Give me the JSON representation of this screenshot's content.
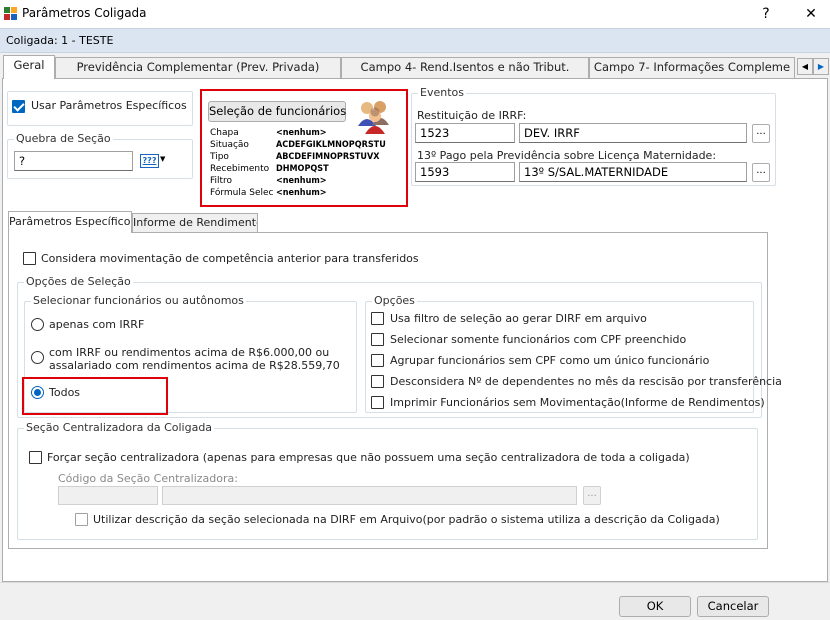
{
  "window": {
    "title": "Parâmetros Coligada",
    "help": "?",
    "close": "✕"
  },
  "infobar": {
    "text": "Coligada: 1 - TESTE"
  },
  "tabs": [
    "Geral",
    "Previdência Complementar (Prev. Privada)",
    "Campo 4- Rend.Isentos e não Tribut.",
    "Campo 7- Informações Compleme"
  ],
  "geral": {
    "usar_parametros_label": "Usar Parâmetros Específicos",
    "usar_parametros_checked": true,
    "quebra_title": "Quebra de Seção",
    "quebra_value": "?",
    "quebra_icon_text": "???"
  },
  "selecao": {
    "button_label": "Seleção de funcionários",
    "rows": [
      {
        "label": "Chapa",
        "value": "<nenhum>"
      },
      {
        "label": "Situação",
        "value": "ACDEFGIKLMNOPQRSTU"
      },
      {
        "label": "Tipo",
        "value": "ABCDEFIMNOPRSTUVX"
      },
      {
        "label": "Recebimento",
        "value": "DHMOPQST"
      },
      {
        "label": "Filtro",
        "value": "<nenhum>"
      },
      {
        "label": "Fórmula Selec",
        "value": "<nenhum>"
      }
    ]
  },
  "eventos": {
    "title": "Eventos",
    "restituicao_label": "Restituição de IRRF:",
    "restituicao_code": "1523",
    "restituicao_desc": "DEV.  IRRF",
    "decimo_label": "13º Pago pela Previdência sobre Licença Maternidade:",
    "decimo_code": "1593",
    "decimo_desc": "13º S/SAL.MATERNIDADE",
    "lookup": "..."
  },
  "subtabs": [
    "Parâmetros Específicos",
    "Informe de Rendimentos"
  ],
  "especificos": {
    "considera_label": "Considera movimentação de competência anterior para transferidos",
    "opcoes_selecao_title": "Opções de Seleção",
    "selecionar_title": "Selecionar funcionários ou autônomos",
    "radio_irrf": "apenas com IRRF",
    "radio_rend_line1": "com IRRF ou rendimentos acima de R$6.000,00 ou",
    "radio_rend_line2": "assalariado com rendimentos acima de R$28.559,70",
    "radio_todos": "Todos",
    "selected": "Todos",
    "opcoes_title": "Opções",
    "opcoes": [
      "Usa filtro de seleção ao gerar DIRF em arquivo",
      "Selecionar somente funcionários com CPF preenchido",
      "Agrupar funcionários sem CPF como um único funcionário",
      "Desconsidera Nº de dependentes no mês da rescisão por transferência",
      "Imprimir Funcionários sem Movimentação(Informe de Rendimentos)"
    ],
    "secao_title": "Seção Centralizadora da Coligada",
    "forcar_label": "Forçar seção centralizadora  (apenas para empresas que não possuem uma seção centralizadora de toda a coligada)",
    "codigo_label": "Código da Seção Centralizadora:",
    "utilizar_label": "Utilizar descrição da seção selecionada na DIRF em Arquivo(por padrão o sistema utiliza a descrição da Coligada)"
  },
  "footer": {
    "ok": "OK",
    "cancel": "Cancelar"
  },
  "colors": {
    "accent": "#0067c0",
    "highlight": "#e0000a",
    "infobar": "#dbe5f1"
  }
}
